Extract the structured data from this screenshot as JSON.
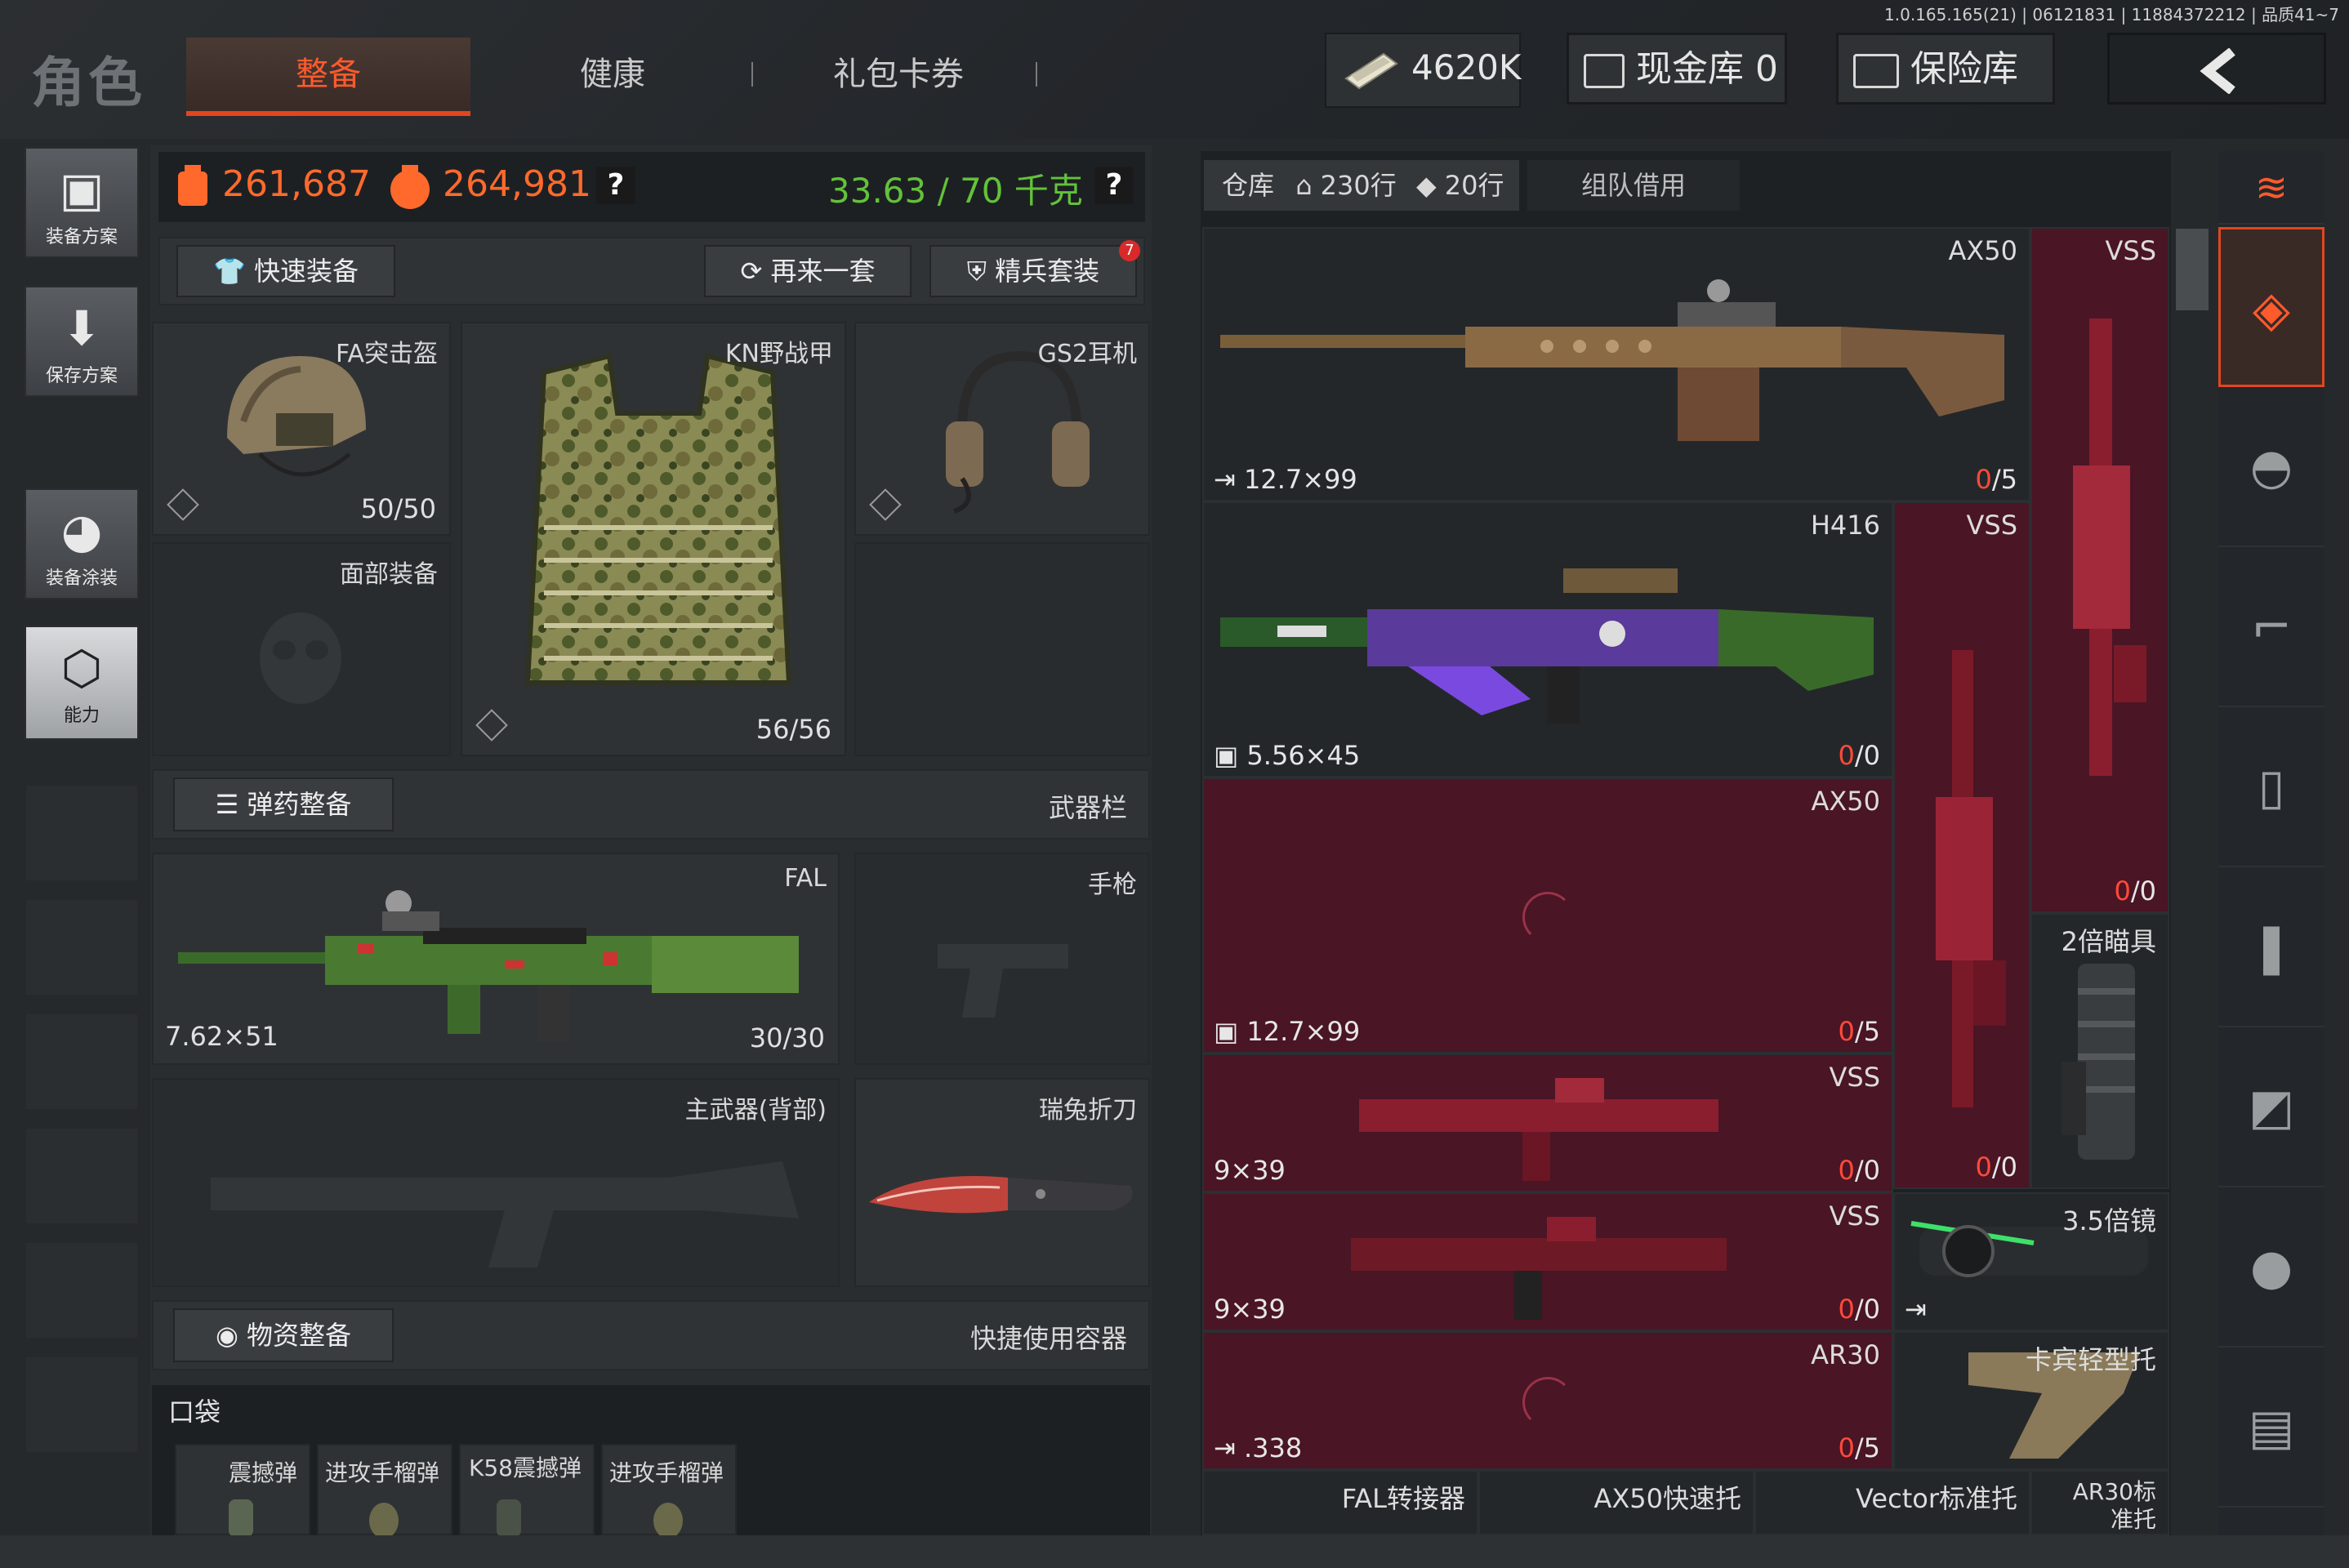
{
  "version": "1.0.165.165(21) | 06121831 | 11884372212 | 品质41~7",
  "header": {
    "title": "角色",
    "tabs": [
      "整备",
      "健康",
      "礼包卡券"
    ],
    "money": "4620K",
    "cash_vault": "现金库 0",
    "safe": "保险库"
  },
  "left_menu": [
    {
      "label": "装备方案"
    },
    {
      "label": "保存方案"
    },
    {
      "label": "装备涂装"
    },
    {
      "label": "能力"
    }
  ],
  "stats": {
    "value1": "261,687",
    "value2": "264,981",
    "weight": "33.63 / 70 千克"
  },
  "equip_actions": {
    "quick": "快速装备",
    "again": "再来一套",
    "elite": "精兵套装",
    "elite_badge": "7"
  },
  "gear": {
    "helmet": {
      "name": "FA突击盔",
      "count": "50/50"
    },
    "armor": {
      "name": "KN野战甲",
      "count": "56/56"
    },
    "headset": {
      "name": "GS2耳机"
    },
    "face": {
      "name": "面部装备"
    }
  },
  "ammo_section": {
    "button": "弹药整备",
    "label": "武器栏"
  },
  "weapons": {
    "primary": {
      "name": "FAL",
      "caliber": "7.62×51",
      "count": "30/30"
    },
    "pistol": {
      "name": "手枪"
    },
    "back": {
      "name": "主武器(背部)"
    },
    "knife": {
      "name": "瑞兔折刀"
    }
  },
  "supply_section": {
    "button": "物资整备",
    "label": "快捷使用容器"
  },
  "pocket": {
    "title": "口袋",
    "items": [
      "震撼弹",
      "进攻手榴弹",
      "K58震撼弹",
      "进攻手榴弹"
    ]
  },
  "warehouse": {
    "tab": "仓库",
    "rows": "230行",
    "rows2": "20行",
    "team": "组队借用",
    "items": [
      {
        "id": "ax50a",
        "name": "AX50",
        "caliber": "12.7×99",
        "count_a": "0",
        "count_b": "/5"
      },
      {
        "id": "vss1",
        "name": "VSS",
        "count_a": "0",
        "count_b": "/0"
      },
      {
        "id": "h416",
        "name": "H416",
        "caliber": "5.56×45",
        "count_a": "0",
        "count_b": "/0"
      },
      {
        "id": "vss2",
        "name": "VSS",
        "count_a": "0",
        "count_b": "/0"
      },
      {
        "id": "ax50b",
        "name": "AX50",
        "caliber": "12.7×99",
        "count_a": "0",
        "count_b": "/5"
      },
      {
        "id": "scope2",
        "name": "2倍瞄具"
      },
      {
        "id": "vss3",
        "name": "VSS",
        "caliber": "9×39",
        "count_a": "0",
        "count_b": "/0"
      },
      {
        "id": "vss4",
        "name": "VSS",
        "caliber": "9×39",
        "count_a": "0",
        "count_b": "/0"
      },
      {
        "id": "scope35",
        "name": "3.5倍镜"
      },
      {
        "id": "ar30",
        "name": "AR30",
        "caliber": ".338",
        "count_a": "0",
        "count_b": "/5"
      },
      {
        "id": "stock",
        "name": "卡宾轻型托"
      },
      {
        "id": "falconv",
        "name": "FAL转接器"
      },
      {
        "id": "ax50stock",
        "name": "AX50快速托"
      },
      {
        "id": "vectorstock",
        "name": "Vector标准托"
      },
      {
        "id": "ar30stock",
        "name": "AR30标准托"
      }
    ]
  },
  "colors": {
    "accent": "#e2461f",
    "weight_green": "#62c23a",
    "value_orange": "#ff6a2c",
    "red_slot": "#4a1525"
  }
}
